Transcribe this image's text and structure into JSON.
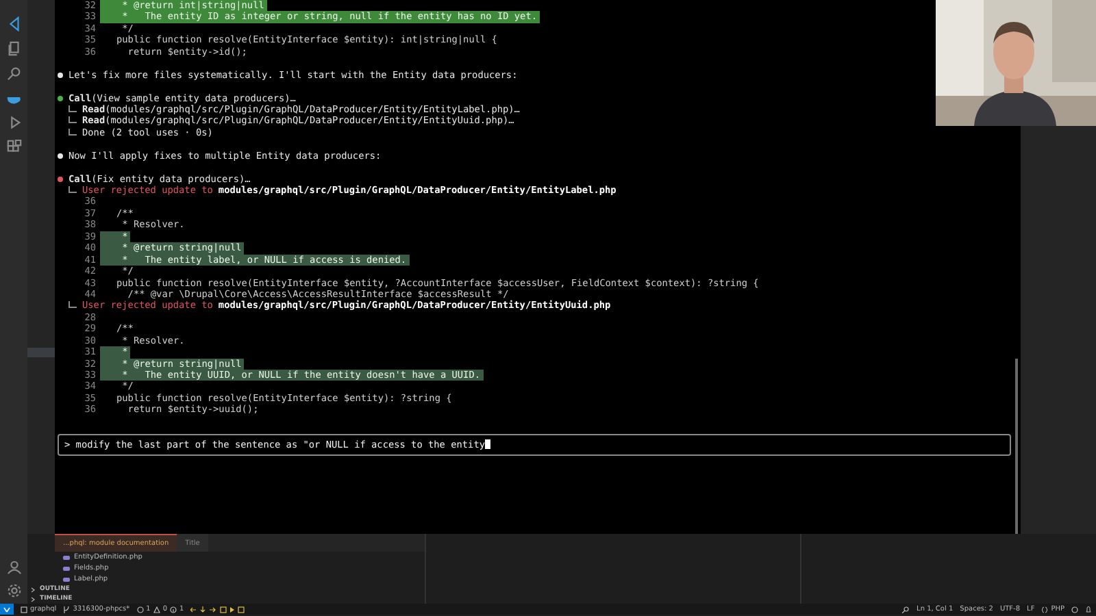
{
  "terminal": {
    "lines": [
      {
        "kind": "code",
        "number": "32",
        "text": " * @return int|string|null",
        "highlighted": true,
        "color": "#3f8a3a"
      },
      {
        "kind": "code",
        "number": "33",
        "text": " *   The entity ID as integer or string, null if the entity has no ID yet.",
        "highlighted": true,
        "color": "#3f8a3a"
      },
      {
        "kind": "code",
        "number": "34",
        "text": " */",
        "highlighted": false
      },
      {
        "kind": "code",
        "number": "35",
        "text": "public function resolve(EntityInterface $entity): int|string|null {",
        "highlighted": false
      },
      {
        "kind": "code",
        "number": "36",
        "text": "  return $entity->id();",
        "highlighted": false
      },
      {
        "kind": "blank"
      },
      {
        "kind": "bullet",
        "color": "#e6e6e6",
        "text": "Let's fix more files systematically. I'll start with the Entity data producers:"
      },
      {
        "kind": "blank"
      },
      {
        "kind": "bullet",
        "color": "#4caf50",
        "text": "**Call**(View sample entity data producers)…"
      },
      {
        "kind": "tree",
        "text": "**Read**(modules/graphql/src/Plugin/GraphQL/DataProducer/Entity/EntityLabel.php)…"
      },
      {
        "kind": "tree",
        "text": "**Read**(modules/graphql/src/Plugin/GraphQL/DataProducer/Entity/EntityUuid.php)…"
      },
      {
        "kind": "tree",
        "text": "Done (2 tool uses · 0s)"
      },
      {
        "kind": "blank"
      },
      {
        "kind": "bullet",
        "color": "#e6e6e6",
        "text": "Now I'll apply fixes to multiple Entity data producers:"
      },
      {
        "kind": "blank"
      },
      {
        "kind": "bullet",
        "color": "#e05561",
        "text": "**Call**(Fix entity data producers)…"
      },
      {
        "kind": "rejected",
        "text": "User rejected update to",
        "path": "modules/graphql/src/Plugin/GraphQL/DataProducer/Entity/EntityLabel.php"
      },
      {
        "kind": "code",
        "number": "36",
        "highlighted": false
      },
      {
        "kind": "code",
        "number": "37",
        "text": "/**",
        "highlighted": false
      },
      {
        "kind": "code",
        "number": "38",
        "text": " * Resolver.",
        "highlighted": false
      },
      {
        "kind": "code",
        "number": "39",
        "text": " *",
        "highlighted": true,
        "color": "#3b5a43"
      },
      {
        "kind": "code",
        "number": "40",
        "text": " * @return string|null",
        "highlighted": true,
        "color": "#3b5a43"
      },
      {
        "kind": "code",
        "number": "41",
        "text": " *   The entity label, or NULL if access is denied.",
        "highlighted": true,
        "color": "#3b5a43"
      },
      {
        "kind": "code",
        "number": "42",
        "text": " */",
        "highlighted": false
      },
      {
        "kind": "code",
        "number": "43",
        "text": "public function resolve(EntityInterface $entity, ?AccountInterface $accessUser, FieldContext $context): ?string {",
        "highlighted": false
      },
      {
        "kind": "code",
        "number": "44",
        "text": "  /** @var \\Drupal\\Core\\Access\\AccessResultInterface $accessResult */",
        "highlighted": false
      },
      {
        "kind": "rejected",
        "text": "User rejected update to",
        "path": "modules/graphql/src/Plugin/GraphQL/DataProducer/Entity/EntityUuid.php"
      },
      {
        "kind": "code",
        "number": "28",
        "highlighted": false
      },
      {
        "kind": "code",
        "number": "29",
        "text": "/**",
        "highlighted": false
      },
      {
        "kind": "code",
        "number": "30",
        "text": " * Resolver.",
        "highlighted": false
      },
      {
        "kind": "code",
        "number": "31",
        "text": " *",
        "highlighted": true,
        "color": "#3b5a43"
      },
      {
        "kind": "code",
        "number": "32",
        "text": " * @return string|null",
        "highlighted": true,
        "color": "#3b5a43"
      },
      {
        "kind": "code",
        "number": "33",
        "text": " *   The entity UUID, or NULL if the entity doesn't have a UUID.",
        "highlighted": true,
        "color": "#3b5a43"
      },
      {
        "kind": "code",
        "number": "34",
        "text": " */",
        "highlighted": false
      },
      {
        "kind": "code",
        "number": "35",
        "text": "public function resolve(EntityInterface $entity): ?string {",
        "highlighted": false
      },
      {
        "kind": "code",
        "number": "36",
        "text": "  return $entity->uuid();",
        "highlighted": false
      }
    ],
    "prompt": {
      "value": "> modify the last part of the sentence as \"or NULL if access to the entity"
    }
  },
  "panel_tabs": [
    {
      "label": "...phql: module documentation",
      "selected": true
    },
    {
      "label": "Title",
      "selected": false
    }
  ],
  "files": [
    "EntityDefinition.php",
    "Fields.php",
    "Label.php"
  ],
  "sections": [
    "OUTLINE",
    "TIMELINE"
  ],
  "status_bar": {
    "branch": "graphql",
    "remote_branch": "3316300-phpcs*",
    "errors": "1",
    "warnings": "0",
    "infos": "1",
    "position": "Ln 1, Col 1",
    "spaces": "Spaces: 2",
    "encoding": "UTF-8",
    "eol": "LF",
    "language": "PHP"
  },
  "webcam": {
    "kind": "picture"
  }
}
